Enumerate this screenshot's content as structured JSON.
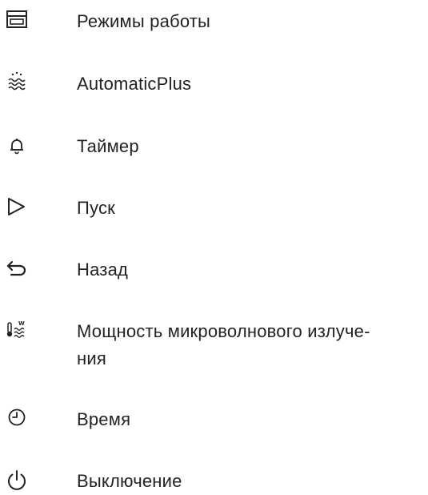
{
  "legend": {
    "items": [
      {
        "icon": "operating-modes-icon",
        "label": "Режимы работы"
      },
      {
        "icon": "automatic-plus-icon",
        "label": "AutomaticPlus"
      },
      {
        "icon": "bell-icon",
        "label": "Таймер"
      },
      {
        "icon": "play-icon",
        "label": "Пуск"
      },
      {
        "icon": "back-arrow-icon",
        "label": "Назад"
      },
      {
        "icon": "microwave-power-icon",
        "label": "Мощность микроволнового излуче-ния"
      },
      {
        "icon": "clock-icon",
        "label": "Время"
      },
      {
        "icon": "power-icon",
        "label": "Выключение"
      }
    ]
  }
}
